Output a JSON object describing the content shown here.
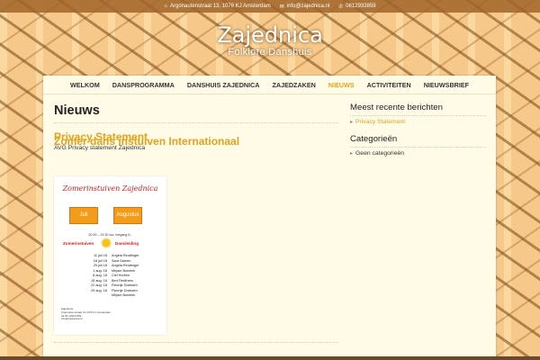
{
  "topbar": {
    "address": "Argonautenstraat 13, 1076 KJ Amsterdam",
    "email": "info@zajednica.nl",
    "phone": "0612933859",
    "icons": [
      "home-icon",
      "envelope-icon",
      "phone-icon"
    ]
  },
  "brand": {
    "title": "Zajednica",
    "subtitle": "Folklore Danshuis"
  },
  "nav": {
    "items": [
      {
        "label": "WELKOM"
      },
      {
        "label": "DANSPROGRAMMA"
      },
      {
        "label": "DANSHUIS ZAJEDNICA"
      },
      {
        "label": "ZAJEDZAKEN"
      },
      {
        "label": "NIEUWS",
        "active": true
      },
      {
        "label": "ACTIVITEITEN"
      },
      {
        "label": "NIEUWSBRIEF"
      }
    ]
  },
  "main": {
    "page_title": "Nieuws",
    "posts": [
      {
        "title": "Privacy Statement",
        "excerpt": "AVG Privacy statement Zajednica"
      },
      {
        "title": "Zomer dans instuiven Internationaal"
      }
    ],
    "poster": {
      "title": "Zomerinstuiven Zajednica",
      "month1": "Juli",
      "month2": "Augustus",
      "time": "20.00 – 23.30 uur, toegang 5,-",
      "label_left": "Zomerinstuiven",
      "label_right": "Dansleiding",
      "rows": [
        {
          "date": "11 juli 18",
          "name": "Angela Reuttinger"
        },
        {
          "date": "18 juli 18",
          "name": "Sara Damen"
        },
        {
          "date": "25 juli 18",
          "name": "Angela Reuttinger"
        },
        {
          "date": "1 aug. 18",
          "name": "Mirjam Boneink"
        },
        {
          "date": "8 aug. 18",
          "name": "Ciel Horben"
        },
        {
          "date": "15 aug. 18",
          "name": "Bert Fiedthers"
        },
        {
          "date": "22 aug. 18",
          "name": "Fleurtje Doeksen"
        },
        {
          "date": "29 aug. 18",
          "name": "Fleurtje Doeksen"
        },
        {
          "date": "",
          "name": "Mirjam Boneink"
        }
      ],
      "footer": [
        "Zajednica",
        "Argonautenstraat 13 1076 KJ Amsterdam",
        "tel 06 12933 859",
        "info@zajednica.nl"
      ]
    }
  },
  "sidebar": {
    "recent_title": "Meest recente berichten",
    "recent_items": [
      "Privacy Statement"
    ],
    "categories_title": "Categorieën",
    "categories_items": [
      "Geen categorieën"
    ]
  },
  "colors": {
    "accent": "#e3a21a",
    "topbar_bg": "#a06428",
    "content_bg": "#fffbe6"
  }
}
